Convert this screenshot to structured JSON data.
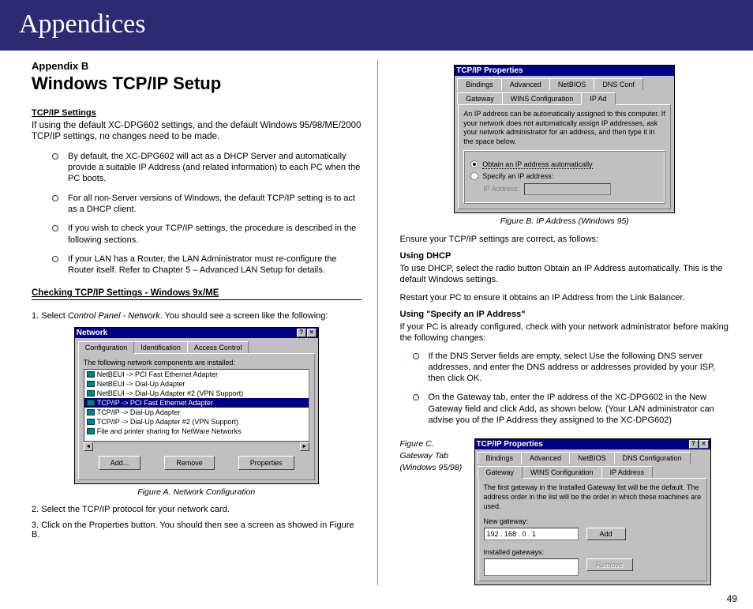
{
  "header": {
    "title": "Appendices"
  },
  "left": {
    "appendix_label": "Appendix B",
    "main_heading": "Windows TCP/IP Setup",
    "s1_heading": "TCP/IP Settings",
    "s1_intro": "If using the default XC-DPG602 settings, and the default Windows 95/98/ME/2000 TCP/IP settings, no changes need to be made.",
    "s1_bullets": [
      "By default, the XC-DPG602 will act as a DHCP Server and automatically provide a suitable IP Address (and related information) to each PC when the PC boots.",
      "For all non-Server versions of Windows, the default TCP/IP setting is to act as a DHCP client.",
      "If you wish to check your TCP/IP settings, the procedure is described in the following sections.",
      "If your LAN has a Router, the LAN Administrator must re-configure the Router itself. Refer to Chapter 5 – Advanced LAN Setup for details."
    ],
    "s2_heading": "Checking TCP/IP Settings - Windows 9x/ME",
    "step1_pre": "1. Select ",
    "step1_em": "Control Panel - Network",
    "step1_post": ". You should see a screen like the following:",
    "figA": {
      "title": "Network",
      "tab1": "Configuration",
      "tab2": "Identification",
      "tab3": "Access Control",
      "listlabel": "The following network components are installed:",
      "rows": [
        "NetBEUI -> PCI Fast Ethernet Adapter",
        "NetBEUI -> Dial-Up Adapter",
        "NetBEUI -> Dial-Up Adapter #2 (VPN Support)",
        "TCP/IP -> PCI Fast Ethernet Adapter",
        "TCP/IP -> Dial-Up Adapter",
        "TCP/IP -> Dial-Up Adapter #2 (VPN Support)",
        "File and printer sharing for NetWare Networks"
      ],
      "btn_add": "Add...",
      "btn_remove": "Remove",
      "btn_props": "Properties",
      "caption": "Figure A. Network Configuration"
    },
    "step2": "2. Select the TCP/IP protocol for your network card.",
    "step3": "3. Click on the Properties button. You should then see a screen as showed in Figure B."
  },
  "right": {
    "figB": {
      "title": "TCP/IP Properties",
      "tabs_row1": [
        "Bindings",
        "Advanced",
        "NetBIOS",
        "DNS Conf"
      ],
      "tabs_row2": [
        "Gateway",
        "WINS Configuration",
        "IP Ad"
      ],
      "desc": "An IP address can be automatically assigned to this computer. If your network does not automatically assign IP addresses, ask your network administrator for an address, and then type it in the space below.",
      "radio1": "Obtain an IP address automatically",
      "radio2": "Specify an IP address:",
      "ip_label": "IP Address:",
      "caption": "Figure B. IP Address (Windows 95)"
    },
    "ensure": "Ensure your TCP/IP settings are correct, as follows:",
    "dhcp_head": "Using DHCP",
    "dhcp_p1": "To use DHCP, select the radio button Obtain an IP Address automatically. This is the default Windows settings.",
    "dhcp_p2": "Restart your PC to ensure it obtains an IP Address from the Link Balancer.",
    "spec_head": "Using \"Specify an IP Address\"",
    "spec_p1": "If your PC is already configured, check with your network administrator before making the following changes:",
    "spec_bullets": [
      "If the DNS Server fields are empty, select Use the following DNS server addresses, and enter the DNS address or addresses provided by your ISP, then click OK.",
      "On the Gateway tab, enter the IP address of the XC-DPG602 in the New Gateway field and click Add, as shown below. (Your LAN administrator can advise you of the IP Address they assigned to the XC-DPG602)"
    ],
    "figC": {
      "caption_l1": "Figure C.",
      "caption_l2": "Gateway Tab",
      "caption_l3": "(Windows 95/98)",
      "title": "TCP/IP Properties",
      "tabs_row1": [
        "Bindings",
        "Advanced",
        "NetBIOS",
        "DNS Configuration"
      ],
      "tabs_row2": [
        "Gateway",
        "WINS Configuration",
        "IP Address"
      ],
      "desc": "The first gateway in the Installed Gateway list will be the default. The address order in the list will be the order in which these machines are used.",
      "new_gw_label": "New gateway:",
      "new_gw_value": "192 . 168 .  0  .   1",
      "btn_add": "Add",
      "installed_label": "Installed gateways:",
      "btn_remove": "Remove"
    }
  },
  "page_number": "49"
}
